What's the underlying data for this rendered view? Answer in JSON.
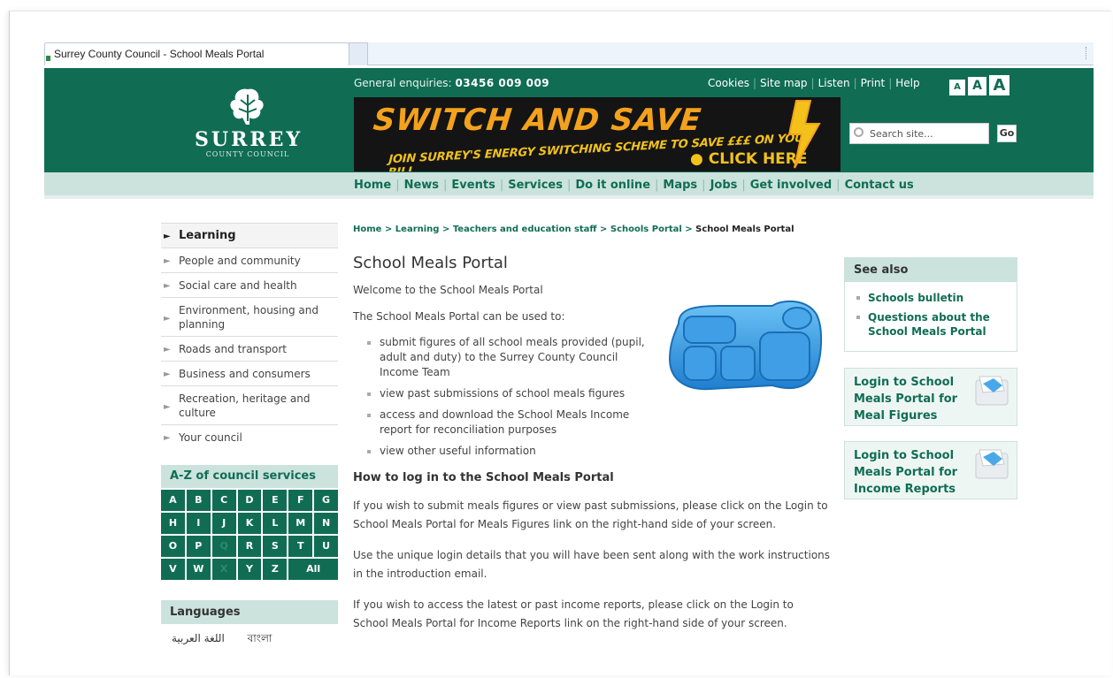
{
  "browser": {
    "tab_title": "Surrey County Council - School Meals Portal"
  },
  "header": {
    "logo_word": "SURREY",
    "logo_sub": "COUNTY COUNCIL",
    "enquiries_label": "General enquiries:",
    "enquiries_phone": "03456 009 009",
    "util_links": [
      "Cookies",
      "Site map",
      "Listen",
      "Print",
      "Help"
    ],
    "text_size": [
      "A",
      "A",
      "A"
    ],
    "banner": {
      "line1": "SWITCH AND SAVE",
      "line2": "JOIN SURREY'S ENERGY SWITCHING SCHEME TO SAVE £££ ON YOUR BILL",
      "line3": "● CLICK HERE"
    },
    "search_placeholder": "Search site...",
    "go_label": "Go",
    "brand_color": "#106d54"
  },
  "nav": [
    "Home",
    "News",
    "Events",
    "Services",
    "Do it online",
    "Maps",
    "Jobs",
    "Get involved",
    "Contact us"
  ],
  "left_nav": [
    {
      "label": "Learning",
      "active": true
    },
    {
      "label": "People and community"
    },
    {
      "label": "Social care and health"
    },
    {
      "label": "Environment, housing and planning"
    },
    {
      "label": "Roads and transport"
    },
    {
      "label": "Business and consumers"
    },
    {
      "label": "Recreation, heritage and culture"
    },
    {
      "label": "Your council"
    }
  ],
  "az": {
    "title": "A-Z of council services",
    "letters": [
      "A",
      "B",
      "C",
      "D",
      "E",
      "F",
      "G",
      "H",
      "I",
      "J",
      "K",
      "L",
      "M",
      "N",
      "O",
      "P",
      "Q",
      "R",
      "S",
      "T",
      "U",
      "V",
      "W",
      "X",
      "Y",
      "Z",
      "All"
    ],
    "dim": [
      "Q",
      "X"
    ]
  },
  "languages": {
    "title": "Languages",
    "items": [
      "اللغة العربية",
      "বাংলা"
    ]
  },
  "breadcrumb": {
    "links": [
      "Home",
      "Learning",
      "Teachers and education staff",
      "Schools Portal"
    ],
    "current": "School Meals Portal",
    "separator": " > "
  },
  "main": {
    "title": "School Meals Portal",
    "welcome": "Welcome to the School Meals Portal",
    "intro": "The School Meals Portal can be used to:",
    "bullets": [
      "submit figures of all school meals provided (pupil, adult and duty) to the Surrey County Council Income Team",
      "view past submissions of school meals figures",
      "access and download the School Meals Income report for reconciliation purposes",
      "view other useful information"
    ],
    "howto_heading": "How to log in to the School Meals Portal",
    "para1": "If you wish to submit meals figures or view past submissions, please click on the Login to School Meals Portal for Meals Figures link on the right-hand side of your screen.",
    "para2": "Use the unique login details that you will have been sent along with the work instructions in the introduction email.",
    "para3": "If you wish to access the latest or past income reports, please click on the Login to School Meals Portal for Income Reports link on the right-hand side of your screen."
  },
  "see_also": {
    "title": "See also",
    "links": [
      "Schools bulletin",
      "Questions about the School Meals Portal"
    ]
  },
  "login_boxes": [
    {
      "label": "Login to School Meals Portal for Meal Figures"
    },
    {
      "label": "Login to School Meals Portal for Income Reports"
    }
  ]
}
